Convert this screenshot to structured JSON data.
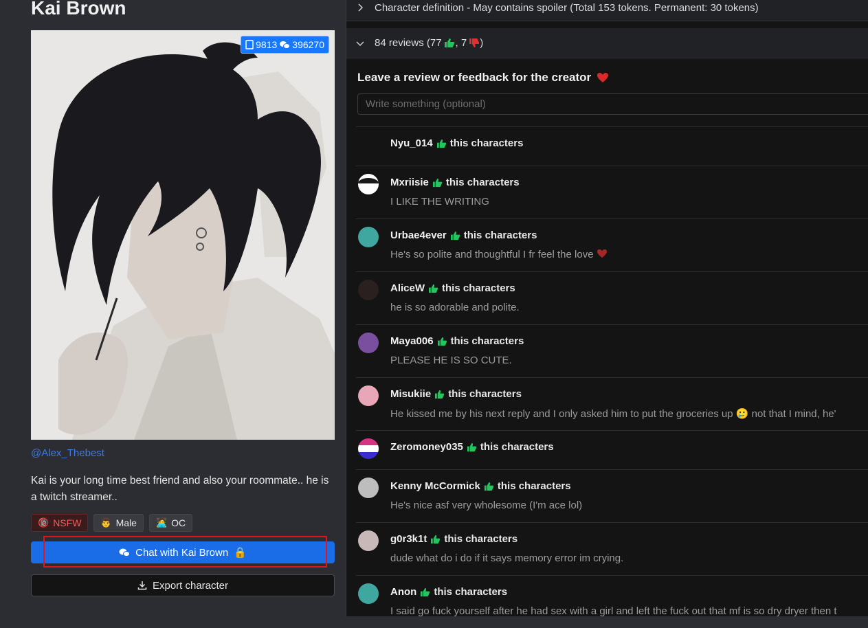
{
  "character": {
    "name": "Kai Brown",
    "creator": "@Alex_Thebest",
    "description": "Kai is your long time best friend and also your roommate.. he is a twitch streamer..",
    "stats": {
      "messages": "9813",
      "chats": "396270"
    },
    "tags": [
      {
        "label": "NSFW",
        "icon": "18-plus-icon"
      },
      {
        "label": "Male",
        "icon": "male-person-icon"
      },
      {
        "label": "OC",
        "icon": "person-at-desk-icon"
      }
    ],
    "chat_button": "Chat with Kai Brown",
    "export_button": "Export character"
  },
  "right": {
    "definition_row": "Character definition - May contains spoiler (Total 153 tokens. Permanent: 30 tokens)",
    "reviews_row": {
      "prefix": "84 reviews (77",
      "middle": ", 7",
      "suffix": ")"
    },
    "leave_review_title": "Leave a review or feedback for the creator",
    "review_placeholder": "Write something (optional)",
    "like_suffix": "this characters",
    "reviews": [
      {
        "user": "Nyu_014",
        "comment": "",
        "avatar_color": "#141414"
      },
      {
        "user": "Mxriisie",
        "comment": "I LIKE THE WRITING",
        "avatar_color": "#2a2a2a"
      },
      {
        "user": "Urbae4ever",
        "comment": "He's so polite and thoughtful I fr feel the love",
        "avatar_color": "#3fa7a0"
      },
      {
        "user": "AliceW",
        "comment": "he is so adorable and polite.",
        "avatar_color": "#2b2020"
      },
      {
        "user": "Maya006",
        "comment": "PLEASE HE IS SO CUTE.",
        "avatar_color": "#7a4fa0"
      },
      {
        "user": "Misukiie",
        "comment": "He kissed me by his next reply and I only asked him to put the groceries up 🥲 not that I mind, he'",
        "avatar_color": "#e7a7b8"
      },
      {
        "user": "Zeromoney035",
        "comment": "",
        "avatar_color": "#8b2fa0"
      },
      {
        "user": "Kenny McCormick",
        "comment": "He's nice asf very wholesome (I'm ace lol)",
        "avatar_color": "#bdbdbd"
      },
      {
        "user": "g0r3k1t",
        "comment": "dude what do i do if it says memory error im crying.",
        "avatar_color": "#c9b8b8"
      },
      {
        "user": "Anon",
        "comment": "I said go fuck yourself after he had sex with a girl and left the fuck out that mf is so dry dryer then t",
        "avatar_color": "#3fa7a0"
      }
    ]
  },
  "colors": {
    "accent": "#1a6de6",
    "like": "#22c55e",
    "dislike": "#e03131",
    "link": "#3f7be0",
    "nsfw": "#ff5a5a"
  }
}
